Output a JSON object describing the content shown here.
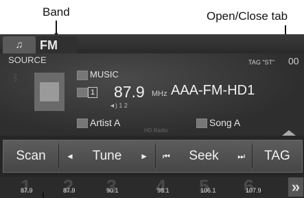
{
  "callouts": {
    "band": "Band",
    "open_close_tab": "Open/Close tab"
  },
  "tabs": {
    "music_icon": "♫",
    "band": "FM"
  },
  "info": {
    "source_label": "SOURCE",
    "music_label": "MUSIC",
    "preset_indicator": "1",
    "frequency": "87.9",
    "unit": "MHz",
    "station": "AAA-FM-HD1",
    "hd_channels": "1 2",
    "artist": "Artist A",
    "song": "Song A",
    "tag_status": "TAG \"ST\"",
    "clock_partial": "00",
    "hd_logo": "HD Radio"
  },
  "controls": {
    "scan": "Scan",
    "tune_down": "◄",
    "tune": "Tune",
    "tune_up": "►",
    "seek_down": "⏮",
    "seek": "Seek",
    "seek_up": "⏭",
    "tag": "TAG"
  },
  "presets": [
    {
      "num": "1",
      "freq": "87.9"
    },
    {
      "num": "2",
      "freq": "87.9"
    },
    {
      "num": "3",
      "freq": "90.1"
    },
    {
      "num": "4",
      "freq": "98.1"
    },
    {
      "num": "5",
      "freq": "106.1"
    },
    {
      "num": "6",
      "freq": "107.9"
    }
  ],
  "more_presets": "»"
}
